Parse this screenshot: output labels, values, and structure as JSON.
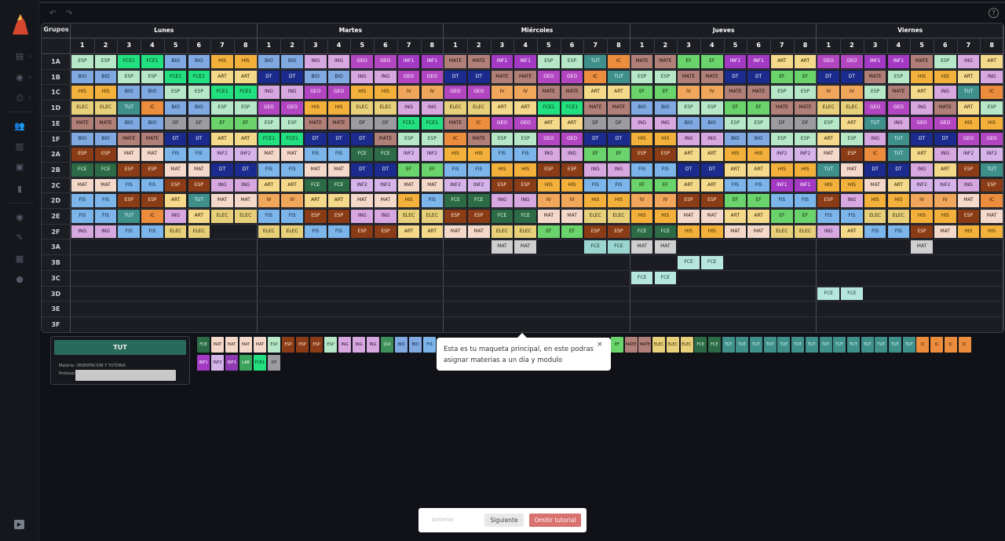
{
  "header": {
    "grupos_label": "Grupos"
  },
  "days": [
    "Lunes",
    "Martes",
    "Miércoles",
    "Jueves",
    "Viernes"
  ],
  "modules": [
    "1",
    "2",
    "3",
    "4",
    "5",
    "6",
    "7",
    "8"
  ],
  "groups": [
    "1A",
    "1B",
    "1C",
    "1D",
    "1E",
    "1F",
    "2A",
    "2B",
    "2C",
    "2D",
    "2E",
    "2F",
    "3A",
    "3B",
    "3C",
    "3D",
    "3E",
    "3F"
  ],
  "colors": {
    "ESP": [
      "#b6e8c7",
      "#1b3b2a"
    ],
    "FCE1": [
      "#22e07f",
      "#0d2a18"
    ],
    "BIO": [
      "#7fa9e0",
      "#10203b"
    ],
    "HIS": [
      "#f3b13c",
      "#3a2400"
    ],
    "ING": [
      "#d7a7e0",
      "#2b1233"
    ],
    "GEO": [
      "#b246c1",
      "#ffffff"
    ],
    "INF1": [
      "#a43ac4",
      "#ffffff"
    ],
    "MATE": [
      "#b07f78",
      "#1e0f0d"
    ],
    "TUT": [
      "#3f8f8b",
      "#e8ffff"
    ],
    "IC": [
      "#ec8d3d",
      "#2a1200"
    ],
    "EF": [
      "#6bd36b",
      "#0e2a0e"
    ],
    "ART": [
      "#f5d98b",
      "#2e2300"
    ],
    "DT": [
      "#1b2b8d",
      "#ffffff"
    ],
    "IV": [
      "#f0a65b",
      "#301800"
    ],
    "ELEC": [
      "#e8d07a",
      "#2e2400"
    ],
    "DF": [
      "#9b9ba0",
      "#1a1a1d"
    ],
    "FCE": [
      "#2c6b45",
      "#e8ffe8"
    ],
    "MAT": [
      "#f4d9cb",
      "#2e1a10"
    ],
    "FIS": [
      "#7cb5ea",
      "#0e2136"
    ],
    "INF2": [
      "#d6b4ea",
      "#2b1638"
    ],
    "ESPd": [
      "#8a3c16",
      "#ffe8d8"
    ],
    "FCEt": [
      "#9ad6cf",
      "#10322d"
    ],
    "MATg": [
      "#cfcfcf",
      "#2a2a2a"
    ],
    "FCEg": [
      "#b6e7dc",
      "#123a31"
    ]
  },
  "schedule": {
    "1A": [
      "ESP",
      "ESP",
      "FCE1",
      "FCE1",
      "BIO",
      "BIO",
      "HIS",
      "HIS",
      "BIO",
      "BIO",
      "ING",
      "ING",
      "GEO",
      "GEO",
      "INF1",
      "INF1",
      "MATE",
      "MATE",
      "INF1",
      "INF1",
      "ESP",
      "ESP",
      "TUT",
      "IC",
      "MATE",
      "MATE",
      "EF",
      "EF",
      "INF1",
      "INF1",
      "ART",
      "ART",
      "GEO",
      "GEO",
      "INF1",
      "INF1",
      "MATE",
      "ESP",
      "ING",
      "ART"
    ],
    "1B": [
      "BIO",
      "BIO",
      "ESP",
      "ESP",
      "FCE1",
      "FCE1",
      "ART",
      "ART",
      "DT",
      "DT",
      "BIO",
      "BIO",
      "ING",
      "ING",
      "GEO",
      "GEO",
      "DT",
      "DT",
      "MATE",
      "MATE",
      "GEO",
      "GEO",
      "IC",
      "TUT",
      "ESP",
      "ESP",
      "MATE",
      "MATE",
      "DT",
      "DT",
      "EF",
      "EF",
      "DT",
      "DT",
      "MATE",
      "ESP",
      "HIS",
      "HIS",
      "ART",
      "ING"
    ],
    "1C": [
      "HIS",
      "HIS",
      "BIO",
      "BIO",
      "ESP",
      "ESP",
      "FCE1",
      "FCE1",
      "ING",
      "ING",
      "GEO",
      "GEO",
      "HIS",
      "HIS",
      "IV",
      "IV",
      "GEO",
      "GEO",
      "IV",
      "IV",
      "MATE",
      "MATE",
      "ART",
      "ART",
      "EF",
      "EF",
      "IV",
      "IV",
      "MATE",
      "MATE",
      "ESP",
      "ESP",
      "IV",
      "IV",
      "ESP",
      "MATE",
      "ART",
      "ING",
      "TUT",
      "IC"
    ],
    "1D": [
      "ELEC",
      "ELEC",
      "TUT",
      "IC",
      "BIO",
      "BIO",
      "ESP",
      "ESP",
      "GEO",
      "GEO",
      "HIS",
      "HIS",
      "ELEC",
      "ELEC",
      "ING",
      "ING",
      "ELEC",
      "ELEC",
      "ART",
      "ART",
      "FCE1",
      "FCE1",
      "MATE",
      "MATE",
      "BIO",
      "BIO",
      "ESP",
      "ESP",
      "EF",
      "EF",
      "MATE",
      "MATE",
      "ELEC",
      "ELEC",
      "GEO",
      "GEO",
      "ING",
      "MATE",
      "ART",
      "ESP"
    ],
    "1E": [
      "MATE",
      "MATE",
      "BIO",
      "BIO",
      "DF",
      "DF",
      "EF",
      "EF",
      "ESP",
      "ESP",
      "MATE",
      "MATE",
      "DF",
      "DF",
      "FCE1",
      "FCE1",
      "MATE",
      "IC",
      "GEO",
      "GEO",
      "ART",
      "ART",
      "DF",
      "DF",
      "ING",
      "ING",
      "BIO",
      "BIO",
      "ESP",
      "ESP",
      "DF",
      "DF",
      "ESP",
      "ART",
      "TUT",
      "ING",
      "GEO",
      "GEO",
      "HIS",
      "HIS"
    ],
    "1F": [
      "BIO",
      "BIO",
      "MATE",
      "MATE",
      "DT",
      "DT",
      "ART",
      "ART",
      "FCE1",
      "FCE1",
      "DT",
      "DT",
      "DT",
      "MATE",
      "ESP",
      "ESP",
      "IC",
      "MATE",
      "ESP",
      "ESP",
      "GEO",
      "GEO",
      "DT",
      "DT",
      "HIS",
      "HIS",
      "ING",
      "ING",
      "BIO",
      "BIO",
      "ESP",
      "ESP",
      "ART",
      "ESP",
      "ING",
      "TUT",
      "DT",
      "DT",
      "GEO",
      "GEO"
    ],
    "2A": [
      "ESPd",
      "ESPd",
      "MAT",
      "MAT",
      "FIS",
      "FIS",
      "INF2",
      "INF2",
      "MAT",
      "MAT",
      "FIS",
      "FIS",
      "FCE",
      "FCE",
      "INF2",
      "INF2",
      "HIS",
      "HIS",
      "FIS",
      "FIS",
      "ING",
      "ING",
      "EF",
      "EF",
      "ESPd",
      "ESPd",
      "ART",
      "ART",
      "HIS",
      "HIS",
      "INF2",
      "INF2",
      "MAT",
      "ESPd",
      "IC",
      "TUT",
      "ART",
      "ING",
      "INF2",
      "INF2"
    ],
    "2B": [
      "FCE",
      "FCE",
      "ESPd",
      "ESPd",
      "MAT",
      "MAT",
      "DT",
      "DT",
      "FIS",
      "FIS",
      "MAT",
      "MAT",
      "DT",
      "DT",
      "EF",
      "EF",
      "FIS",
      "FIS",
      "HIS",
      "HIS",
      "ESPd",
      "ESPd",
      "ING",
      "ING",
      "FIS",
      "FIS",
      "DT",
      "DT",
      "ART",
      "ART",
      "HIS",
      "HIS",
      "TUT",
      "MAT",
      "DT",
      "DT",
      "ING",
      "ART",
      "ESPd",
      "TUT"
    ],
    "2C": [
      "MAT",
      "MAT",
      "FIS",
      "FIS",
      "ESPd",
      "ESPd",
      "ING",
      "ING",
      "ART",
      "ART",
      "FCE",
      "FCE",
      "INF2",
      "INF2",
      "MAT",
      "MAT",
      "INF2",
      "INF2",
      "ESPd",
      "ESPd",
      "HIS",
      "HIS",
      "FIS",
      "FIS",
      "EF",
      "EF",
      "ART",
      "ART",
      "FIS",
      "FIS",
      "INF1",
      "INF1",
      "HIS",
      "HIS",
      "MAT",
      "ART",
      "INF2",
      "INF2",
      "ING",
      "ESPd"
    ],
    "2D": [
      "FIS",
      "FIS",
      "ESPd",
      "ESPd",
      "ART",
      "TUT",
      "MAT",
      "MAT",
      "IV",
      "IV",
      "ART",
      "ART",
      "MAT",
      "MAT",
      "HIS",
      "FIS",
      "FCE",
      "FCE",
      "ING",
      "ING",
      "IV",
      "IV",
      "HIS",
      "HIS",
      "IV",
      "IV",
      "ESPd",
      "ESPd",
      "EF",
      "EF",
      "FIS",
      "FIS",
      "ESPd",
      "ING",
      "HIS",
      "HIS",
      "IV",
      "IV",
      "MAT",
      "IC"
    ],
    "2E": [
      "FIS",
      "FIS",
      "TUT",
      "IC",
      "ING",
      "ART",
      "ELEC",
      "ELEC",
      "FIS",
      "FIS",
      "ESPd",
      "ESPd",
      "ING",
      "ING",
      "ELEC",
      "ELEC",
      "ESPd",
      "ESPd",
      "FCE",
      "FCE",
      "MAT",
      "MAT",
      "ELEC",
      "ELEC",
      "HIS",
      "HIS",
      "MAT",
      "MAT",
      "ART",
      "ART",
      "EF",
      "EF",
      "FIS",
      "FIS",
      "ELEC",
      "ELEC",
      "HIS",
      "HIS",
      "ESPd",
      "MAT"
    ],
    "2F": [
      "ING",
      "ING",
      "FIS",
      "FIS",
      "ELEC",
      "ELEC",
      "",
      "",
      "ELEC",
      "ELEC",
      "FIS",
      "FIS",
      "ESPd",
      "ESPd",
      "ART",
      "ART",
      "MAT",
      "MAT",
      "ELEC",
      "ELEC",
      "EF",
      "EF",
      "ESPd",
      "ESPd",
      "FCE",
      "FCE",
      "HIS",
      "HIS",
      "MAT",
      "MAT",
      "ELEC",
      "ELEC",
      "ING",
      "ART",
      "FIS",
      "FIS",
      "ESPd",
      "MAT",
      "HIS",
      "HIS"
    ],
    "3A": [
      "",
      "",
      "",
      "",
      "",
      "",
      "",
      "",
      "",
      "",
      "",
      "",
      "",
      "",
      "",
      "",
      "",
      "",
      "MATg",
      "MATg",
      "",
      "",
      "FCEt",
      "FCEt",
      "MATg",
      "MATg",
      "",
      "",
      "",
      "",
      "",
      "",
      "",
      "",
      "",
      "",
      "MATg",
      "",
      "",
      ""
    ],
    "3B": [
      "",
      "",
      "",
      "",
      "",
      "",
      "",
      "",
      "",
      "",
      "",
      "",
      "",
      "",
      "",
      "",
      "",
      "",
      "",
      "",
      "",
      "",
      "",
      "",
      "",
      "",
      "FCEg",
      "FCEg",
      "",
      "",
      "",
      "",
      "",
      "",
      "",
      "",
      "",
      "",
      "",
      ""
    ],
    "3C": [
      "",
      "",
      "",
      "",
      "",
      "",
      "",
      "",
      "",
      "",
      "",
      "",
      "",
      "",
      "",
      "",
      "",
      "",
      "",
      "",
      "",
      "",
      "",
      "",
      "FCEg",
      "FCEg",
      "",
      "",
      "",
      "",
      "",
      "",
      "",
      "",
      "",
      "",
      "",
      "",
      "",
      ""
    ],
    "3D": [
      "",
      "",
      "",
      "",
      "",
      "",
      "",
      "",
      "",
      "",
      "",
      "",
      "",
      "",
      "",
      "",
      "",
      "",
      "",
      "",
      "",
      "",
      "",
      "",
      "",
      "",
      "",
      "",
      "",
      "",
      "",
      "",
      "FCEg",
      "FCEg",
      "",
      "",
      "",
      "",
      "",
      ""
    ],
    "3E": [
      "",
      "",
      "",
      "",
      "",
      "",
      "",
      "",
      "",
      "",
      "",
      "",
      "",
      "",
      "",
      "",
      "",
      "",
      "",
      "",
      "",
      "",
      "",
      "",
      "",
      "",
      "",
      "",
      "",
      "",
      "",
      "",
      "",
      "",
      "",
      "",
      "",
      "",
      "",
      ""
    ],
    "3F": [
      "",
      "",
      "",
      "",
      "",
      "",
      "",
      "",
      "",
      "",
      "",
      "",
      "",
      "",
      "",
      "",
      "",
      "",
      "",
      "",
      "",
      "",
      "",
      "",
      "",
      "",
      "",
      "",
      "",
      "",
      "",
      "",
      "",
      "",
      "",
      "",
      "",
      "",
      "",
      ""
    ]
  },
  "tray1": [
    "FCE",
    "MAT",
    "MAT",
    "MAT",
    "MAT",
    "ESP",
    "ESPd",
    "ESPd",
    "ESPd",
    "ESP",
    "ING",
    "ING",
    "ING",
    "QUI",
    "BIO",
    "BIO",
    "FIS"
  ],
  "tray1b": [
    "EF",
    "MATE",
    "MATE",
    "ELEC",
    "ELEC",
    "ELEC",
    "FCE",
    "FCE",
    "TUT",
    "TUT",
    "TUT",
    "TUT",
    "TUT",
    "TUT",
    "TUT",
    "TUT",
    "TUT",
    "TUT",
    "TUT",
    "TUT",
    "TUT",
    "TUT",
    "IC",
    "IC",
    "IC",
    "IC"
  ],
  "tray2": [
    "INF1",
    "INF2",
    "INF3",
    "LAB",
    "FCE1",
    "DF"
  ],
  "panel": {
    "subject": "TUT",
    "materia": "Materia: ORIENTACION Y TUTORIA",
    "profesor": "Profesor:"
  },
  "tooltip": {
    "text": "Esta es tu maqueta principal, en este podras asignar materias a un dia y modulo",
    "close": "×"
  },
  "tutorial": {
    "prev": "Anterior",
    "next": "Siguiente",
    "skip": "Omitir tutorial"
  },
  "toolbar": {
    "undo": "↶",
    "redo": "↷",
    "help": "?"
  }
}
